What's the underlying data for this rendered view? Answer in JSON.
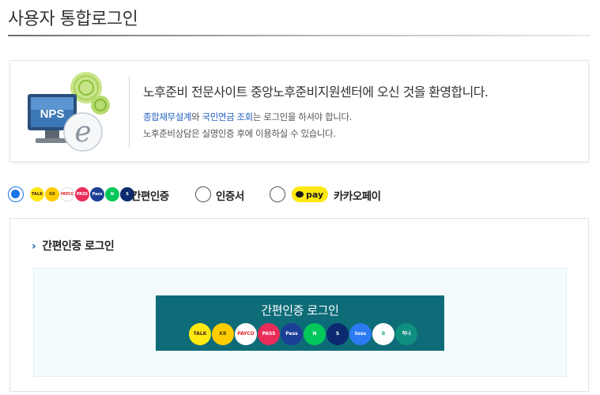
{
  "page": {
    "title": "사용자 통합로그인"
  },
  "welcome": {
    "logo_text": "NPS",
    "title": "노후준비 전문사이트 중앙노후준비지원센터에 오신 것을 환영합니다.",
    "line1_highlight_a": "종합재무설계",
    "line1_mid": "와 ",
    "line1_highlight_b": "국민연금 조회",
    "line1_rest": "는 로그인을 하셔야 합니다.",
    "line2": "노후준비상담은 실명인증 후에 이용하실 수 있습니다."
  },
  "auth_options": [
    {
      "label": "간편인증",
      "selected": true
    },
    {
      "label": "인증서",
      "selected": false
    },
    {
      "label": "카카오페이",
      "selected": false,
      "badge": "pay"
    }
  ],
  "provider_icons": [
    {
      "name": "kakao-talk",
      "text": "TALK",
      "bg": "#ffe812",
      "fg": "#3a1d1d"
    },
    {
      "name": "kb",
      "text": "KB",
      "bg": "#ffcc00",
      "fg": "#5a4a00"
    },
    {
      "name": "payco",
      "text": "PAYCO",
      "bg": "#ffffff",
      "fg": "#e0242a"
    },
    {
      "name": "pass",
      "text": "PASS",
      "bg": "#ea2c5a",
      "fg": "#ffffff"
    },
    {
      "name": "samsung-pass",
      "text": "Pass",
      "bg": "#1c3f96",
      "fg": "#ffffff"
    },
    {
      "name": "naver",
      "text": "N",
      "bg": "#03c75a",
      "fg": "#ffffff"
    },
    {
      "name": "shinhan",
      "text": "S",
      "bg": "#0b2a6f",
      "fg": "#ffffff"
    },
    {
      "name": "toss",
      "text": "toss",
      "bg": "#2b7bf5",
      "fg": "#ffffff"
    },
    {
      "name": "banksalad",
      "text": "B",
      "bg": "#ffffff",
      "fg": "#2bb673"
    },
    {
      "name": "hana",
      "text": "하나",
      "bg": "#0f8f7f",
      "fg": "#ffffff"
    }
  ],
  "panel": {
    "heading": "간편인증 로그인",
    "button_label": "간편인증 로그인"
  },
  "colors": {
    "accent": "#1a73e8",
    "button_bg": "#0e6c78",
    "panel_bg": "#f4fbfd",
    "link_blue": "#1f5fbf"
  }
}
